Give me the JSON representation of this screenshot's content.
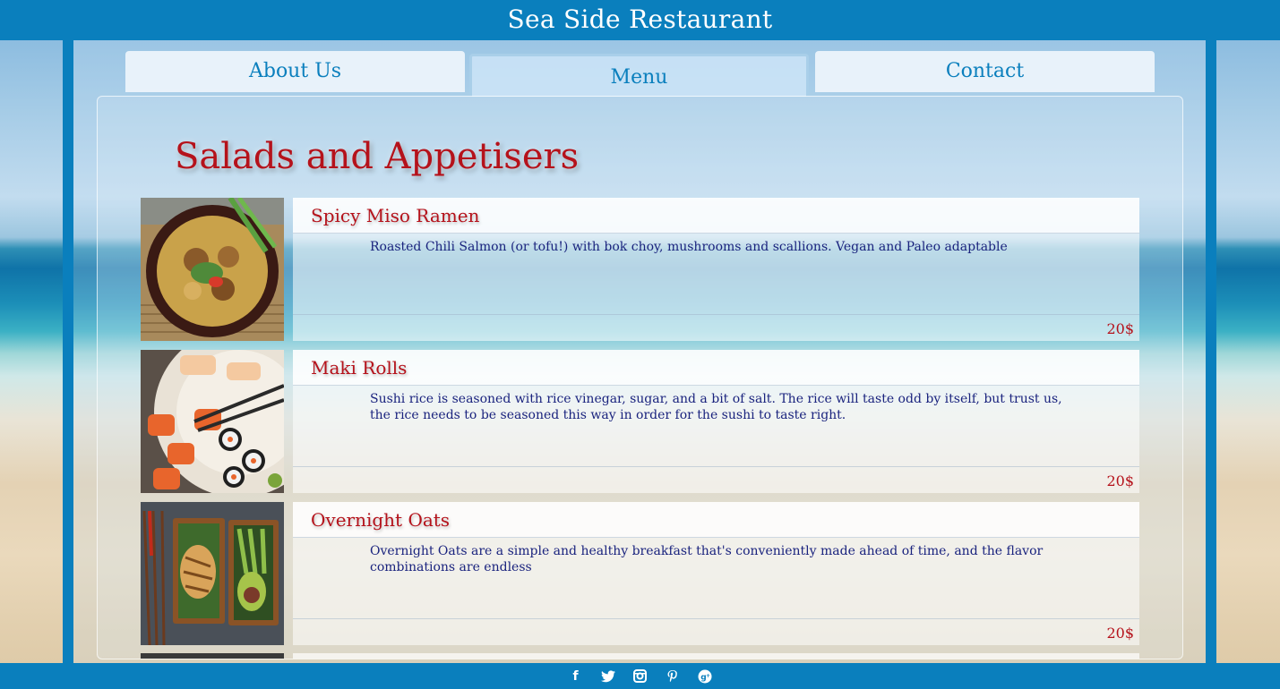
{
  "header": {
    "title": "Sea Side Restaurant"
  },
  "tabs": [
    {
      "label": "About Us",
      "active": false
    },
    {
      "label": "Menu",
      "active": true
    },
    {
      "label": "Contact",
      "active": false
    }
  ],
  "section": {
    "title": "Salads and Appetisers"
  },
  "menu_items": [
    {
      "name": "Spicy Miso Ramen",
      "description": "Roasted Chili Salmon (or tofu!) with bok choy, mushrooms and scallions. Vegan and Paleo adaptable",
      "price": "20$",
      "photo_icon": "ramen-bowl-photo"
    },
    {
      "name": "Maki Rolls",
      "description": "Sushi rice is seasoned with rice vinegar, sugar, and a bit of salt. The rice will taste odd by itself, but trust us, the rice needs to be seasoned this way in order for the sushi to taste right.",
      "price": "20$",
      "photo_icon": "sushi-plate-photo"
    },
    {
      "name": "Overnight Oats",
      "description": "Overnight Oats are a simple and healthy breakfast that's conveniently made ahead of time, and the flavor combinations are endless",
      "price": "20$",
      "photo_icon": "bento-box-photo"
    }
  ],
  "footer": {
    "social": [
      "facebook-icon",
      "twitter-icon",
      "instagram-icon",
      "pinterest-icon",
      "google-plus-icon"
    ]
  },
  "colors": {
    "brand_blue": "#0a7fbd",
    "title_red": "#b5121b",
    "description_navy": "#1a237e"
  }
}
